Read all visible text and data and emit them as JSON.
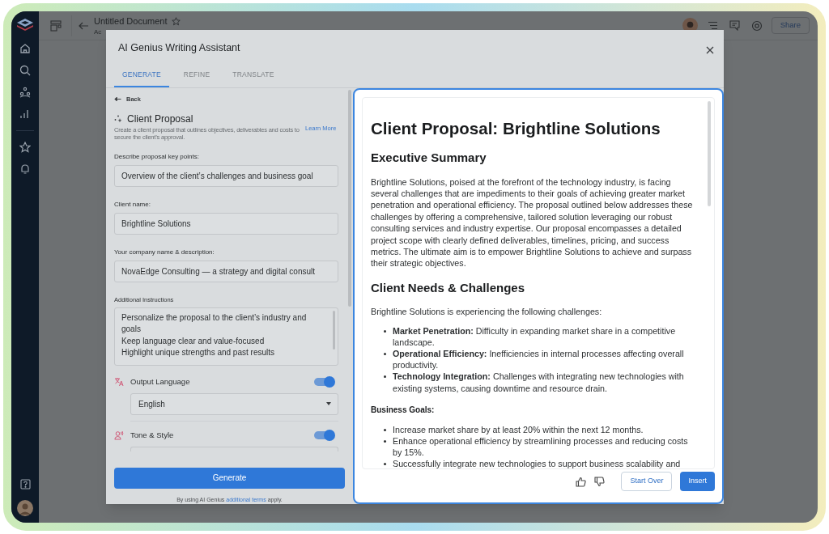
{
  "app": {
    "document_title": "Untitled Document",
    "starred": false,
    "document_subtitle": "Ac",
    "share_button": "Share"
  },
  "dialog": {
    "title": "AI Genius Writing Assistant",
    "tabs": [
      {
        "label": "GENERATE",
        "selected": true
      },
      {
        "label": "REFINE",
        "selected": false
      },
      {
        "label": "TRANSLATE",
        "selected": false
      }
    ],
    "back_link": "Back",
    "template": {
      "title": "Client Proposal",
      "description": "Create a client proposal that outlines objectives, deliverables and costs to secure the client’s approval.",
      "link": "Learn More"
    },
    "fields": [
      {
        "kind": "input",
        "label": "Describe proposal key points:",
        "value": "Overview of the client’s challenges and business goal"
      },
      {
        "kind": "input",
        "label": "Client name:",
        "value": "Brightline Solutions"
      },
      {
        "kind": "input",
        "label": "Your company name & description:",
        "value": "NovaEdge Consulting — a strategy and digital consult"
      },
      {
        "kind": "textarea",
        "label": "Additional Instructions",
        "lines": [
          "Personalize the proposal to the client’s industry and goals",
          "Keep language clear and value-focused",
          "Highlight unique strengths and past results"
        ]
      }
    ],
    "options": [
      {
        "kind": "language",
        "label": "Output Language",
        "on": true,
        "value": "English"
      },
      {
        "kind": "tone",
        "label": "Tone & Style",
        "on": true
      }
    ],
    "generate_button": "Generate",
    "footer": {
      "before": "By using AI Genius",
      "link": "additional terms",
      "after": "apply."
    }
  },
  "preview": {
    "blocks": [
      {
        "kind": "title",
        "text": "Client Proposal: Brightline Solutions"
      },
      {
        "kind": "heading",
        "text": "Executive Summary"
      },
      {
        "kind": "paragraph",
        "text": "Brightline Solutions, poised at the forefront of the technology industry, is facing several challenges that are impediments to their goals of achieving greater market penetration and operational efficiency. The proposal outlined below addresses these challenges by offering a comprehensive, tailored solution leveraging our robust consulting services and industry expertise. Our proposal encompasses a detailed project scope with clearly defined deliverables, timelines, pricing, and success metrics. The ultimate aim is to empower Brightline Solutions to achieve and surpass their strategic objectives."
      },
      {
        "kind": "heading",
        "text": "Client Needs & Challenges"
      },
      {
        "kind": "paragraph",
        "text": "Brightline Solutions is experiencing the following challenges:"
      },
      {
        "kind": "list",
        "items": [
          "**Market Penetration:** Difficulty in expanding market share in a competitive landscape.",
          "**Operational Efficiency:** Inefficiencies in internal processes affecting overall productivity.",
          "**Technology Integration:** Challenges with integrating new technologies with existing systems, causing downtime and resource drain."
        ]
      },
      {
        "kind": "subheading",
        "text": "Business Goals:"
      },
      {
        "kind": "list",
        "items": [
          "Increase market share by at least 20% within the next 12 months.",
          "Enhance operational efficiency by streamlining processes and reducing costs by 15%.",
          "Successfully integrate new technologies to support business scalability and"
        ]
      }
    ],
    "start_over_button": "Start Over",
    "insert_button": "Insert"
  }
}
